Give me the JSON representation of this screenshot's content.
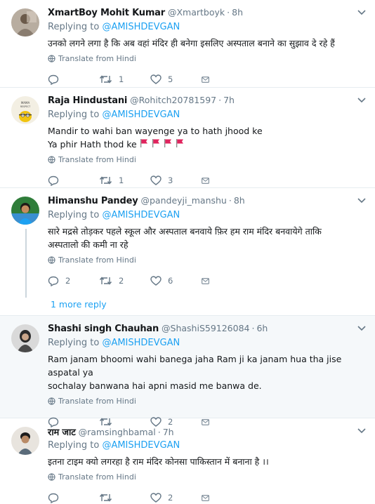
{
  "tweets": [
    {
      "name": "XmartBoy Mohit Kumar",
      "handle": "@Xmartboyk",
      "time": "8h",
      "replying_label": "Replying to",
      "replying_to": "@AMISHDEVGAN",
      "lines": [
        "उनको लगने लगा है कि अब वहां मंदिर ही बनेगा इसलिए अस्पताल बनाने का सुझाव दे रहे हैं"
      ],
      "translate": "Translate from Hindi",
      "reply_count": "",
      "retweet_count": "1",
      "like_count": "5"
    },
    {
      "name": "Raja Hindustani",
      "handle": "@Rohitch20781597",
      "time": "7h",
      "replying_label": "Replying to",
      "replying_to": "@AMISHDEVGAN",
      "lines": [
        "Mandir to  wahi ban wayenge ya to hath jhood ke",
        "Ya phir Hath thod ke"
      ],
      "flag_emoji": "red-flag",
      "translate": "Translate from Hindi",
      "reply_count": "",
      "retweet_count": "1",
      "like_count": "3"
    },
    {
      "name": "Himanshu Pandey",
      "handle": "@pandeyji_manshu",
      "time": "8h",
      "replying_label": "Replying to",
      "replying_to": "@AMISHDEVGAN",
      "lines": [
        "सारे मद्रसे तोड़कर पहले स्कूल और अस्पताल बनवाये फ़िर हम राम मंदिर बनवायेगे ताकि",
        "अस्पतालो की कमी ना रहे"
      ],
      "translate": "Translate from Hindi",
      "reply_count": "2",
      "retweet_count": "2",
      "like_count": "6",
      "more_replies": "1 more reply"
    },
    {
      "name": "Shashi singh Chauhan",
      "handle": "@ShashiS59126084",
      "time": "6h",
      "replying_label": "Replying to",
      "replying_to": "@AMISHDEVGAN",
      "lines": [
        "Ram janam bhoomi wahi banega jaha Ram ji ka janam hua tha jise aspatal ya",
        "sochalay banwana hai apni masid me banwa de."
      ],
      "translate": "Translate from Hindi",
      "reply_count": "",
      "retweet_count": "",
      "like_count": "2"
    },
    {
      "name": "राम जाट",
      "handle": "@ramsinghbamal",
      "time": "7h",
      "replying_label": "Replying to",
      "replying_to": "@AMISHDEVGAN",
      "lines": [
        "इतना टाइम क्यो लगरहा है राम मंदिर कोनसा पाकिस्तान में बनाना है ।।"
      ],
      "translate": "Translate from Hindi",
      "reply_count": "",
      "retweet_count": "",
      "like_count": "2"
    }
  ],
  "colors": {
    "link": "#1da1f2",
    "muted": "#657786",
    "flag": "#e0245e"
  }
}
